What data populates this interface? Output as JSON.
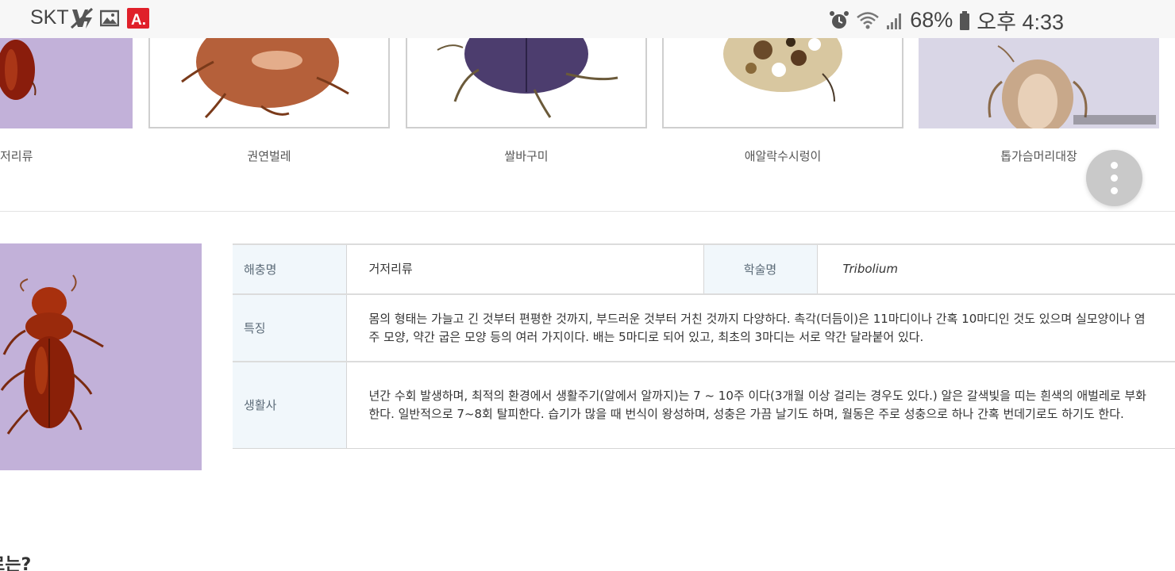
{
  "status_bar": {
    "carrier": "SKT",
    "battery": "68%",
    "time": "오후 4:33"
  },
  "carousel": {
    "items": [
      {
        "caption": "저리류"
      },
      {
        "caption": "권연벌레"
      },
      {
        "caption": "쌀바구미"
      },
      {
        "caption": "애알락수시렁이"
      },
      {
        "caption": "톱가슴머리대장"
      }
    ]
  },
  "info_table": {
    "row1": {
      "name_label": "해충명",
      "name_value": "거저리류",
      "sci_label": "학술명",
      "sci_value": "Tribolium"
    },
    "row2": {
      "label": "특징",
      "value": "몸의 형태는 가늘고 긴 것부터 편평한 것까지, 부드러운 것부터 거친 것까지 다양하다. 촉각(더듬이)은 11마디이나 간혹 10마디인 것도 있으며 실모양이나 염주 모양, 약간 굽은 모양 등의 여러 가지이다. 배는 5마디로 되어 있고, 최초의 3마디는 서로 약간 달라붙어 있다."
    },
    "row3": {
      "label": "생활사",
      "value": "년간 수회 발생하며, 최적의 환경에서 생활주기(알에서 알까지)는 7 ~ 10주 이다(3개월 이상 걸리는 경우도 있다.) 알은 갈색빛을 띠는 흰색의 애벌레로 부화한다. 일반적으로 7~8회 탈피한다. 습기가 많을 때 번식이 왕성하며, 성충은 가끔 날기도 하며, 월동은 주로 성충으로 하나 간혹 번데기로도 하기도 한다."
    }
  },
  "section_heading": "로는?",
  "colors": {
    "status_bg": "#f7f7f7",
    "thumb_purple": "#c2b1d9",
    "table_header_bg": "#f1f7fb",
    "fab": "#c9c9c9",
    "notify_red": "#e0202a"
  }
}
